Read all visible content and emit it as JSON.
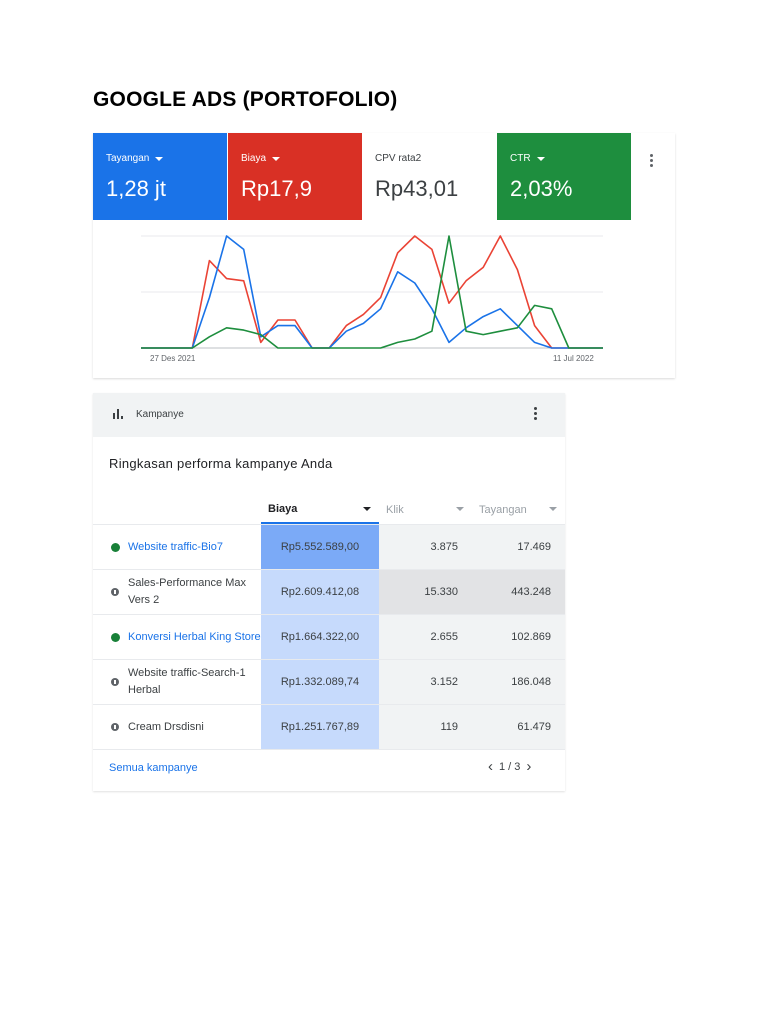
{
  "page": {
    "title": "GOOGLE ADS (PORTOFOLIO)"
  },
  "metrics": [
    {
      "label": "Tayangan",
      "value": "1,28 jt",
      "color": "#1a73e8",
      "has_dropdown": true
    },
    {
      "label": "Biaya",
      "value": "Rp17,9",
      "color": "#d93025",
      "has_dropdown": true
    },
    {
      "label": "CPV rata2",
      "value": "Rp43,01",
      "color": "#ffffff",
      "has_dropdown": false
    },
    {
      "label": "CTR",
      "value": "2,03%",
      "color": "#1e8e3e",
      "has_dropdown": true
    }
  ],
  "chart_data": {
    "type": "line",
    "x_labels": [
      "27 Des 2021",
      "11 Jul 2022"
    ],
    "yaxis_labels": "none",
    "grid": true,
    "series": [
      {
        "color": "#ea4335",
        "values": [
          0,
          0,
          0,
          0,
          78,
          62,
          60,
          5,
          25,
          25,
          0,
          0,
          20,
          30,
          45,
          85,
          100,
          88,
          40,
          60,
          72,
          100,
          70,
          20,
          0,
          0,
          0,
          0
        ]
      },
      {
        "color": "#1a73e8",
        "values": [
          0,
          0,
          0,
          0,
          45,
          100,
          88,
          10,
          20,
          20,
          0,
          0,
          15,
          22,
          35,
          68,
          58,
          35,
          5,
          18,
          28,
          35,
          20,
          5,
          0,
          0,
          0,
          0
        ]
      },
      {
        "color": "#1e8e3e",
        "values": [
          0,
          0,
          0,
          0,
          10,
          18,
          16,
          12,
          0,
          0,
          0,
          0,
          0,
          0,
          0,
          5,
          8,
          15,
          100,
          15,
          12,
          15,
          18,
          38,
          35,
          0,
          0,
          0
        ]
      }
    ]
  },
  "campaign_card": {
    "header_title": "Kampanye",
    "subtitle": "Ringkasan performa kampanye Anda",
    "columns": {
      "cost": "Biaya",
      "clicks": "Klik",
      "views": "Tayangan"
    },
    "rows": [
      {
        "name": "Website traffic-Bio7",
        "status": "active",
        "cost": "Rp5.552.589,00",
        "clicks": "3.875",
        "views": "17.469",
        "cost_share": 1.0,
        "highlight": "none"
      },
      {
        "name": "Sales-Performance Max Vers 2",
        "status": "paused",
        "cost": "Rp2.609.412,08",
        "clicks": "15.330",
        "views": "443.248",
        "cost_share": 0.47,
        "highlight": "max"
      },
      {
        "name": "Konversi Herbal King Store",
        "status": "active",
        "cost": "Rp1.664.322,00",
        "clicks": "2.655",
        "views": "102.869",
        "cost_share": 0.3,
        "highlight": "none"
      },
      {
        "name": "Website traffic-Search-1 Herbal",
        "status": "paused",
        "cost": "Rp1.332.089,74",
        "clicks": "3.152",
        "views": "186.048",
        "cost_share": 0.24,
        "highlight": "none"
      },
      {
        "name": "Cream Drsdisni",
        "status": "paused",
        "cost": "Rp1.251.767,89",
        "clicks": "119",
        "views": "61.479",
        "cost_share": 0.23,
        "highlight": "none"
      }
    ],
    "footer_link": "Semua kampanye",
    "pagination": "1 / 3"
  }
}
